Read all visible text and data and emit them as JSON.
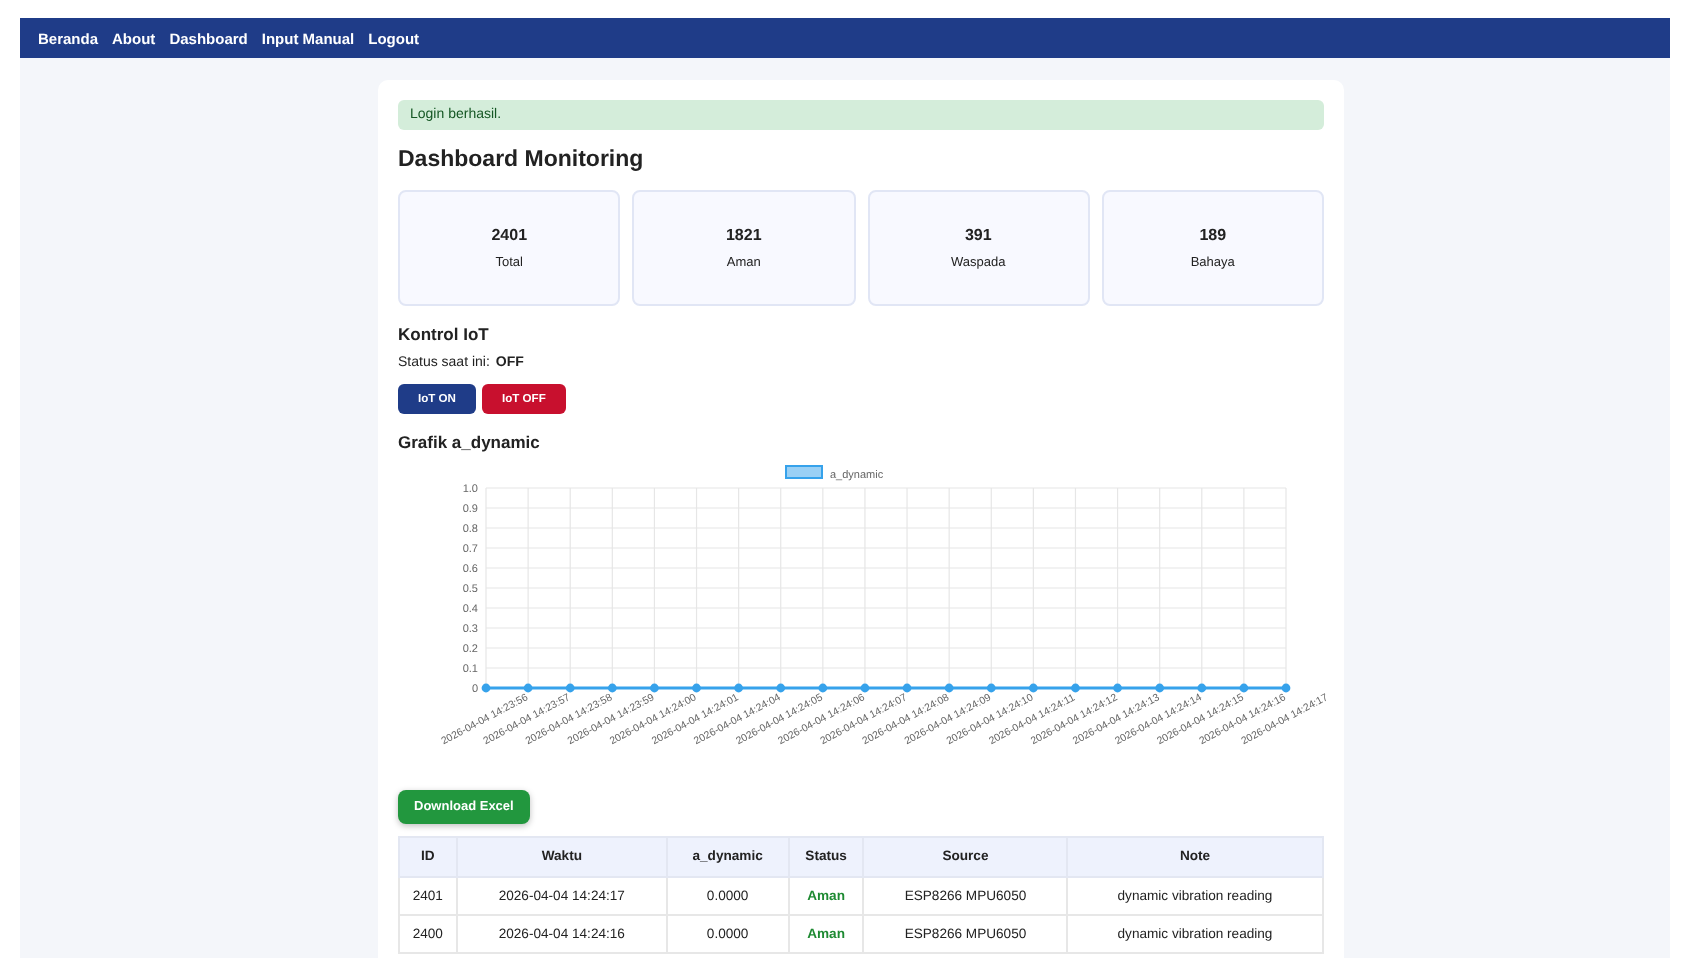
{
  "nav": [
    "Beranda",
    "About",
    "Dashboard",
    "Input Manual",
    "Logout"
  ],
  "alert": "Login berhasil.",
  "title": "Dashboard Monitoring",
  "stats": [
    {
      "value": "2401",
      "label": "Total"
    },
    {
      "value": "1821",
      "label": "Aman"
    },
    {
      "value": "391",
      "label": "Waspada"
    },
    {
      "value": "189",
      "label": "Bahaya"
    }
  ],
  "iot": {
    "heading": "Kontrol IoT",
    "status_label": "Status saat ini:",
    "status_value": "OFF",
    "buttons": [
      {
        "label": "IoT ON",
        "kind": "on"
      },
      {
        "label": "IoT OFF",
        "kind": "off"
      }
    ]
  },
  "chart_heading": "Grafik a_dynamic",
  "chart_data": {
    "type": "line",
    "categories": [
      "2026-04-04 14:23:56",
      "2026-04-04 14:23:57",
      "2026-04-04 14:23:58",
      "2026-04-04 14:23:59",
      "2026-04-04 14:24:00",
      "2026-04-04 14:24:01",
      "2026-04-04 14:24:04",
      "2026-04-04 14:24:05",
      "2026-04-04 14:24:06",
      "2026-04-04 14:24:07",
      "2026-04-04 14:24:08",
      "2026-04-04 14:24:09",
      "2026-04-04 14:24:10",
      "2026-04-04 14:24:11",
      "2026-04-04 14:24:12",
      "2026-04-04 14:24:13",
      "2026-04-04 14:24:14",
      "2026-04-04 14:24:15",
      "2026-04-04 14:24:16",
      "2026-04-04 14:24:17"
    ],
    "grid": true,
    "series": [
      {
        "name": "a_dynamic",
        "color": "#36a2eb",
        "marker": true,
        "values": [
          0,
          0,
          0,
          0,
          0,
          0,
          0,
          0,
          0,
          0,
          0,
          0,
          0,
          0,
          0,
          0,
          0,
          0,
          0,
          0
        ]
      }
    ],
    "ylim": [
      0,
      1
    ],
    "yticks": [
      {
        "value": 0,
        "label": "0"
      },
      {
        "value": 0.1,
        "label": "0.1"
      },
      {
        "value": 0.2,
        "label": "0.2"
      },
      {
        "value": 0.3,
        "label": "0.3"
      },
      {
        "value": 0.4,
        "label": "0.4"
      },
      {
        "value": 0.5,
        "label": "0.5"
      },
      {
        "value": 0.6,
        "label": "0.6"
      },
      {
        "value": 0.7,
        "label": "0.7"
      },
      {
        "value": 0.8,
        "label": "0.8"
      },
      {
        "value": 0.9,
        "label": "0.9"
      },
      {
        "value": 1,
        "label": "1.0"
      }
    ]
  },
  "download_button": "Download Excel",
  "table": {
    "columns": [
      "ID",
      "Waktu",
      "a_dynamic",
      "Status",
      "Source",
      "Note"
    ],
    "rows": [
      [
        "2401",
        "2026-04-04 14:24:17",
        "0.0000",
        "Aman",
        "ESP8266 MPU6050",
        "dynamic vibration reading"
      ],
      [
        "2400",
        "2026-04-04 14:24:16",
        "0.0000",
        "Aman",
        "ESP8266 MPU6050",
        "dynamic vibration reading"
      ]
    ]
  }
}
